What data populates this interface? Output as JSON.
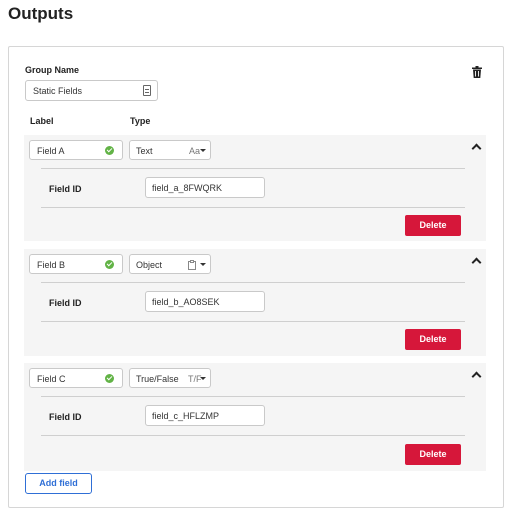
{
  "page": {
    "title": "Outputs"
  },
  "group": {
    "label": "Group Name",
    "value": "Static Fields"
  },
  "columns": {
    "label": "Label",
    "type": "Type"
  },
  "fields": [
    {
      "label": "Field A",
      "type": "Text",
      "type_icon": "Aa",
      "id_label": "Field ID",
      "id_value": "field_a_8FWQRK",
      "delete_label": "Delete"
    },
    {
      "label": "Field B",
      "type": "Object",
      "type_icon": "clipboard-icon",
      "id_label": "Field ID",
      "id_value": "field_b_AO8SEK",
      "delete_label": "Delete"
    },
    {
      "label": "Field C",
      "type": "True/False",
      "type_icon": "T/F",
      "id_label": "Field ID",
      "id_value": "field_c_HFLZMP",
      "delete_label": "Delete"
    }
  ],
  "actions": {
    "add_field": "Add field"
  },
  "colors": {
    "danger": "#d6173a",
    "primary": "#2f6fd6",
    "success": "#62b346"
  }
}
